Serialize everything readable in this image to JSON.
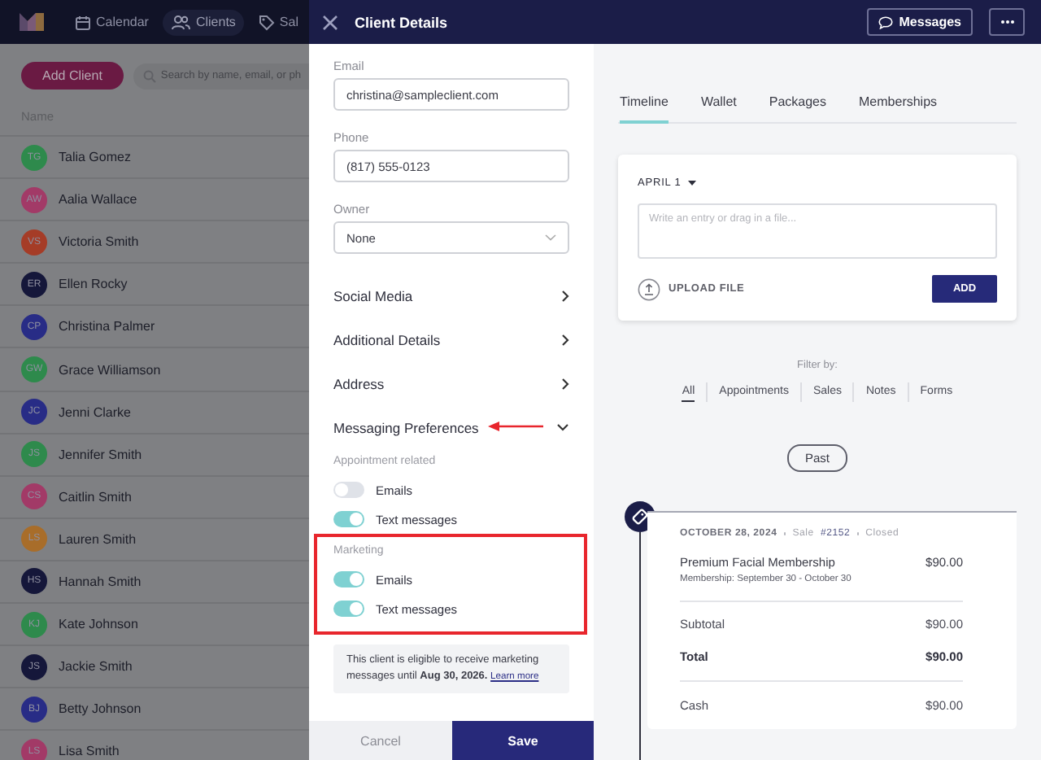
{
  "app": {
    "nav": [
      {
        "label": "Calendar",
        "selected": false
      },
      {
        "label": "Clients",
        "selected": true
      },
      {
        "label": "Sal",
        "selected": false
      }
    ],
    "add_client": "Add Client",
    "search": {
      "placeholder": "Search by name, email, or ph"
    },
    "column": "Name",
    "clients": [
      {
        "initials": "TG",
        "name": "Talia Gomez",
        "color": "#2e8a4c"
      },
      {
        "initials": "AW",
        "name": "Aalia Wallace",
        "color": "#a23a67"
      },
      {
        "initials": "VS",
        "name": "Victoria Smith",
        "color": "#a53c27"
      },
      {
        "initials": "ER",
        "name": "Ellen Rocky",
        "color": "#15173a"
      },
      {
        "initials": "CP",
        "name": "Christina Palmer",
        "color": "#282c86"
      },
      {
        "initials": "GW",
        "name": "Grace Williamson",
        "color": "#2e8a4c"
      },
      {
        "initials": "JC",
        "name": "Jenni Clarke",
        "color": "#282c86"
      },
      {
        "initials": "JS",
        "name": "Jennifer Smith",
        "color": "#2e8a4c"
      },
      {
        "initials": "CS",
        "name": "Caitlin Smith",
        "color": "#a23a67"
      },
      {
        "initials": "LS",
        "name": "Lauren Smith",
        "color": "#a86d2a"
      },
      {
        "initials": "HS",
        "name": "Hannah Smith",
        "color": "#15173a"
      },
      {
        "initials": "KJ",
        "name": "Kate Johnson",
        "color": "#2e8a4c"
      },
      {
        "initials": "JS",
        "name": "Jackie Smith",
        "color": "#15173a"
      },
      {
        "initials": "BJ",
        "name": "Betty Johnson",
        "color": "#282c86"
      },
      {
        "initials": "LS",
        "name": "Lisa Smith",
        "color": "#a23a67"
      }
    ]
  },
  "modal": {
    "title": "Client Details",
    "messages_button": "Messages",
    "fields": [
      {
        "label": "Email",
        "value": "christina@sampleclient.com",
        "kind": "text"
      },
      {
        "label": "Phone",
        "value": "(817) 555-0123",
        "kind": "text"
      },
      {
        "label": "Owner",
        "value": "None",
        "kind": "select"
      }
    ],
    "sections": [
      {
        "label": "Social Media",
        "expanded": false,
        "annotated": false
      },
      {
        "label": "Additional Details",
        "expanded": false,
        "annotated": false
      },
      {
        "label": "Address",
        "expanded": false,
        "annotated": false
      },
      {
        "label": "Messaging Preferences",
        "expanded": true,
        "annotated": true
      }
    ],
    "preference_groups": [
      {
        "title": "Appointment related",
        "highlighted": false,
        "options": [
          {
            "label": "Emails",
            "on": false
          },
          {
            "label": "Text messages",
            "on": true
          }
        ]
      },
      {
        "title": "Marketing",
        "highlighted": true,
        "options": [
          {
            "label": "Emails",
            "on": true
          },
          {
            "label": "Text messages",
            "on": true
          }
        ]
      }
    ],
    "notice": "This client is eligible to receive marketing messages until **Aug 30, 2026.**",
    "notice_link": "Learn more",
    "cancel": "Cancel",
    "save": "Save",
    "tabs": [
      {
        "label": "Timeline",
        "selected": true
      },
      {
        "label": "Wallet",
        "selected": false
      },
      {
        "label": "Packages",
        "selected": false
      },
      {
        "label": "Memberships",
        "selected": false
      }
    ],
    "entry": {
      "date": "APRIL 1",
      "placeholder": "Write an entry or drag in a file...",
      "upload": "UPLOAD FILE",
      "add": "ADD"
    },
    "filter_label": "Filter by:",
    "filters": [
      {
        "label": "All",
        "selected": true
      },
      {
        "label": "Appointments",
        "selected": false
      },
      {
        "label": "Sales",
        "selected": false
      },
      {
        "label": "Notes",
        "selected": false
      },
      {
        "label": "Forms",
        "selected": false
      }
    ],
    "past": "Past",
    "sale": {
      "date": "OCTOBER 28, 2024",
      "sale_label": "Sale",
      "sale_number": "#2152",
      "status": "Closed",
      "items": [
        {
          "name": "Premium Facial Membership",
          "detail": "Membership: September 30 - October 30",
          "price": "$90.00"
        }
      ],
      "subtotal_label": "Subtotal",
      "subtotal": "$90.00",
      "total_label": "Total",
      "total": "$90.00",
      "payments": [
        {
          "method": "Cash",
          "amount": "$90.00"
        }
      ]
    }
  }
}
